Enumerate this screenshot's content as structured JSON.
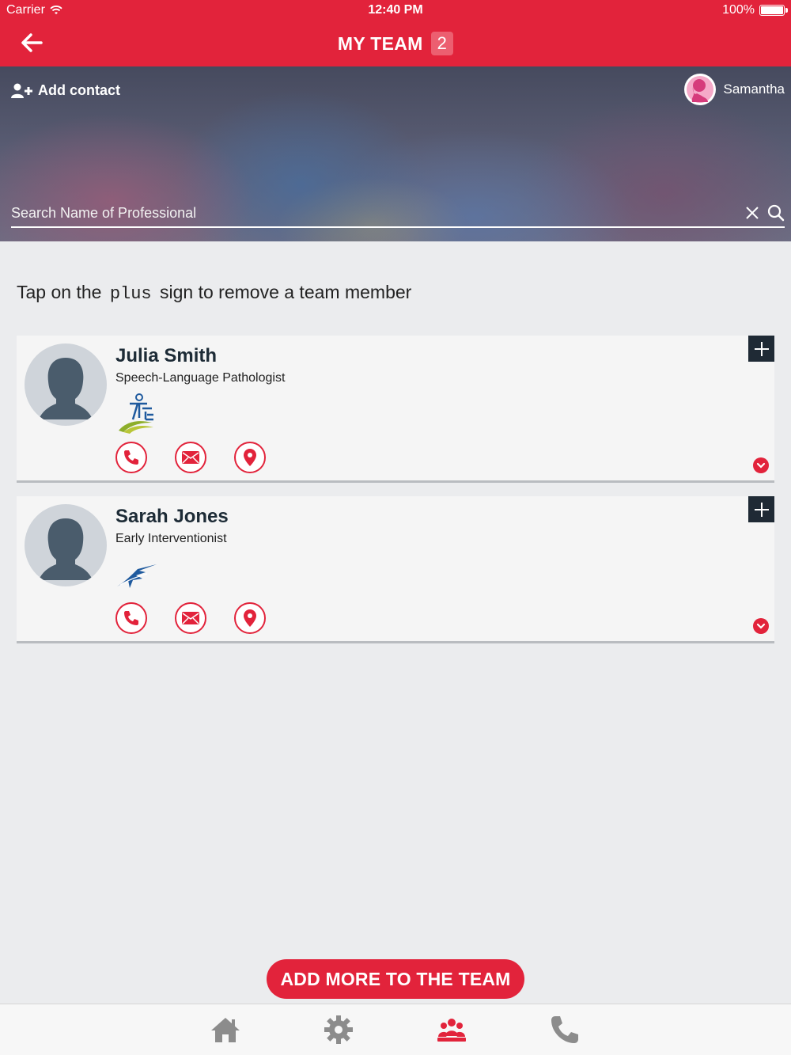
{
  "status_bar": {
    "carrier": "Carrier",
    "time": "12:40 PM",
    "battery": "100%"
  },
  "header": {
    "title": "MY TEAM",
    "count": "2"
  },
  "hero": {
    "add_contact_label": "Add contact",
    "user_name": "Samantha",
    "search": {
      "placeholder": "Search Name of Professional",
      "value": ""
    }
  },
  "hint": {
    "prefix": "Tap on the",
    "keyword": "plus",
    "suffix": "sign to remove a team member"
  },
  "team": [
    {
      "name": "Julia Smith",
      "role": "Speech-Language Pathologist",
      "logo": "speech-association-logo"
    },
    {
      "name": "Sarah Jones",
      "role": "Early Interventionist",
      "logo": "early-intervention-logo"
    }
  ],
  "add_more_label": "ADD MORE TO THE TEAM",
  "tabs": [
    "home-icon",
    "settings-gear-icon",
    "team-icon",
    "phone-icon"
  ],
  "colors": {
    "accent": "#e2233b",
    "dark": "#1f2a35",
    "tab_inactive": "#8c8c8c"
  }
}
